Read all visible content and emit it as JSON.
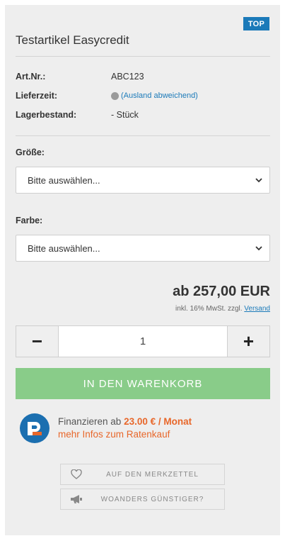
{
  "badge": "TOP",
  "product": {
    "title": "Testartikel Easycredit"
  },
  "info": [
    {
      "label": "Art.Nr.:",
      "value": "ABC123"
    },
    {
      "label": "Lieferzeit:",
      "value": "(Ausland abweichend)"
    },
    {
      "label": "Lagerbestand:",
      "value": "- Stück"
    }
  ],
  "options": {
    "size": {
      "label": "Größe:",
      "selected": "Bitte auswählen..."
    },
    "color": {
      "label": "Farbe:",
      "selected": "Bitte auswählen..."
    }
  },
  "price": {
    "text": "ab 257,00 EUR",
    "tax_prefix": "inkl. 16% MwSt. zzgl.",
    "shipping_link": "Versand"
  },
  "quantity": {
    "minus": "−",
    "value": "1",
    "plus": "+"
  },
  "cart_button": "IN DEN WARENKORB",
  "financing": {
    "prefix": "Finanzieren ab",
    "rate": "23.00 € / Monat",
    "link": "mehr Infos zum Ratenkauf"
  },
  "actions": {
    "wishlist": "AUF DEN MERKZETTEL",
    "cheaper": "WOANDERS GÜNSTIGER?"
  },
  "colors": {
    "accent_blue": "#1b7ab9",
    "cart_green": "#89cc89",
    "finance_orange": "#e8672a"
  }
}
